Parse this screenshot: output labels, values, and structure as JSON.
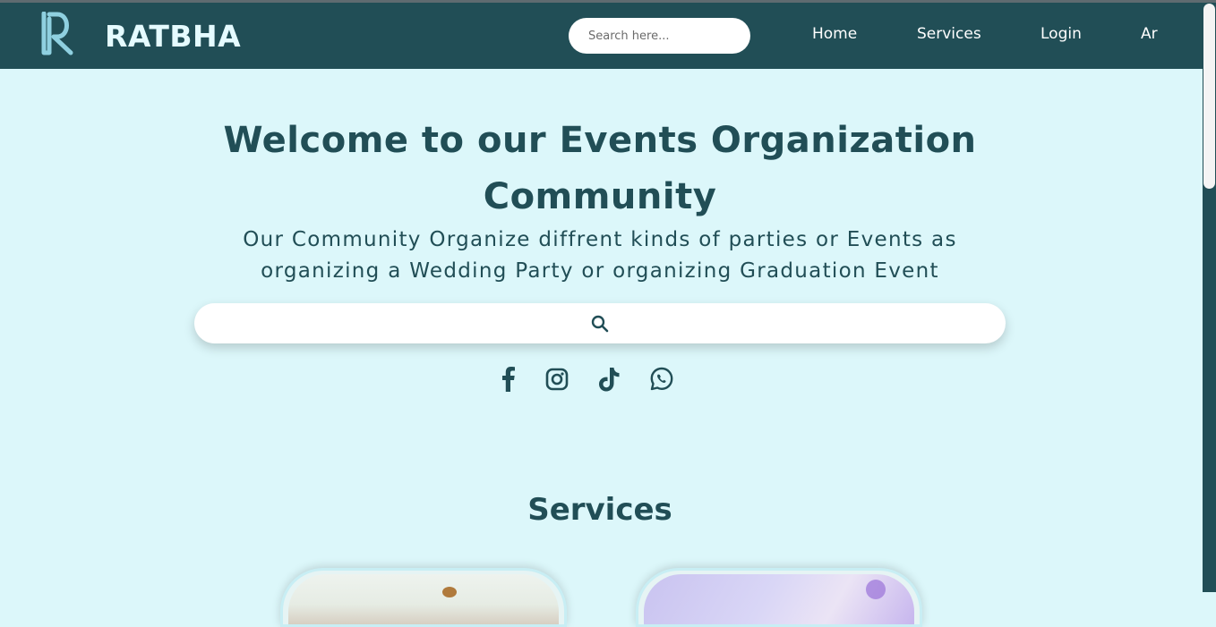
{
  "brand": {
    "name": "RATBHA"
  },
  "nav": {
    "search_placeholder": "Search here...",
    "links": [
      "Home",
      "Services",
      "Login",
      "Ar"
    ]
  },
  "hero": {
    "title": "Welcome to our Events Organization Community",
    "subtitle": "Our Community Organize diffrent kinds of parties or Events as organizing a Wedding Party or organizing Graduation Event",
    "search_placeholder": ""
  },
  "social": {
    "icons": [
      "facebook-icon",
      "instagram-icon",
      "tiktok-icon",
      "whatsapp-icon"
    ]
  },
  "services": {
    "title": "Services"
  },
  "colors": {
    "primary": "#214e56",
    "background": "#dcf7fa",
    "logo": "#8fd0e0"
  }
}
